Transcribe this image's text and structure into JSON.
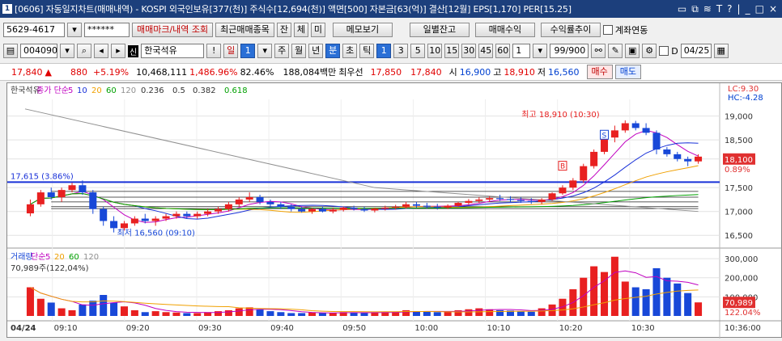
{
  "window": {
    "icon": "1",
    "title": "[0606] 자동일지차트(매매내역) - KOSPI 외국인보유[377(천)] 주식수[12,694(천)] 액면[500] 자본금[63(억)] 결산[12월] EPS[1,170] PER[15.25]",
    "controls": [
      "▭",
      "⧉",
      "≋",
      "T",
      "?",
      "|",
      "_",
      "□",
      "×"
    ]
  },
  "toolbar1": {
    "account": "5629-4617",
    "password": "******",
    "trade_mark_btn": "매매마크/내역 조회",
    "recent_btn": "최근매매종목",
    "btn_jan": "잔",
    "btn_che": "체",
    "btn_mi": "미",
    "memo_btn": "메모보기",
    "daily_btn": "일별잔고",
    "profit_btn": "매매수익",
    "rate_btn": "수익률추이",
    "account_link": "계좌연동"
  },
  "toolbar2": {
    "code": "004090",
    "name": "한국석유",
    "s_badge": "신",
    "period_day": "일",
    "period_num": "1",
    "periods": [
      "주",
      "월",
      "년"
    ],
    "minute_tabs": [
      "분",
      "초",
      "틱"
    ],
    "intervals": [
      "1",
      "3",
      "5",
      "10",
      "15",
      "30",
      "45",
      "60"
    ],
    "count_sel": "1",
    "count": "99/900",
    "date": "04/25",
    "d_label": "D"
  },
  "quote": {
    "price": "17,840",
    "change": "880",
    "rate": "+5.19%",
    "volume": "10,468,111",
    "vol_rate": "1,486.96%",
    "ratio": "82.46%",
    "amount": "188,084백만",
    "best_label": "최우선",
    "ask": "17,850",
    "bid": "17,840",
    "open_label": "시",
    "open": "16,900",
    "high_label": "고",
    "high": "18,910",
    "low_label": "저",
    "low": "16,560",
    "buy_btn": "매수",
    "sell_btn": "매도"
  },
  "chart_data": {
    "type": "candlestick",
    "price_legend": {
      "name": "한국석유",
      "ma_label": "종가 단순",
      "ma_periods": [
        "5",
        "10",
        "20",
        "60",
        "120"
      ],
      "fibs": [
        "0.236",
        "0.5",
        "0.382",
        "0.618"
      ]
    },
    "lc": "LC:9.30",
    "hc": "HC:-4.28",
    "y_ticks": [
      19000,
      18500,
      18100,
      17500,
      17000,
      16500
    ],
    "y_labels": [
      "19,000",
      "18,500",
      "18,100",
      "17,500",
      "17,000",
      "16,500"
    ],
    "last_pct": "0.89%",
    "ylim": [
      16300,
      19350
    ],
    "ref_line": {
      "value": 17615,
      "label": "17,615 (3.86%)"
    },
    "high_annot": "최고 18,910 (10:30)",
    "low_annot": "최저 16,560 (09:10)",
    "markers": {
      "buy": "B",
      "sell": "S"
    },
    "volume_legend": {
      "name": "거래량",
      "ma_label": "단순",
      "ma_periods": [
        "5",
        "20",
        "60",
        "120"
      ],
      "current": "70,989주(122,04%)"
    },
    "vol_ticks": [
      300000,
      200000,
      100000
    ],
    "vol_labels": [
      "300,000",
      "200,000",
      "100,000"
    ],
    "vol_last": "70,989",
    "vol_pct": "122.04%",
    "vol_max": 330000,
    "x_labels": [
      "04/24",
      "09:10",
      "09:20",
      "09:30",
      "09:40",
      "09:50",
      "10:00",
      "10:10",
      "10:20",
      "10:30",
      "10:36:00"
    ],
    "candles": [
      [
        16960,
        17250,
        16900,
        17150
      ],
      [
        17150,
        17450,
        17100,
        17400
      ],
      [
        17400,
        17500,
        17250,
        17300
      ],
      [
        17300,
        17500,
        17200,
        17450
      ],
      [
        17450,
        17600,
        17400,
        17550
      ],
      [
        17550,
        17650,
        17350,
        17400
      ],
      [
        17400,
        17450,
        16950,
        17050
      ],
      [
        17050,
        17100,
        16700,
        16800
      ],
      [
        16800,
        16900,
        16560,
        16650
      ],
      [
        16650,
        16800,
        16600,
        16750
      ],
      [
        16750,
        16900,
        16700,
        16850
      ],
      [
        16850,
        16950,
        16750,
        16800
      ],
      [
        16800,
        16900,
        16700,
        16850
      ],
      [
        16850,
        16950,
        16800,
        16900
      ],
      [
        16900,
        17000,
        16850,
        16950
      ],
      [
        16950,
        17000,
        16850,
        16900
      ],
      [
        16900,
        17000,
        16850,
        16950
      ],
      [
        16950,
        17050,
        16900,
        17000
      ],
      [
        17000,
        17100,
        16950,
        17050
      ],
      [
        17050,
        17200,
        17000,
        17150
      ],
      [
        17150,
        17300,
        17100,
        17250
      ],
      [
        17250,
        17400,
        17200,
        17300
      ],
      [
        17300,
        17350,
        17150,
        17200
      ],
      [
        17200,
        17250,
        17100,
        17150
      ],
      [
        17150,
        17200,
        17050,
        17100
      ],
      [
        17100,
        17150,
        17000,
        17050
      ],
      [
        17050,
        17100,
        16980,
        17000
      ],
      [
        17000,
        17080,
        16950,
        17050
      ],
      [
        17050,
        17100,
        16980,
        17000
      ],
      [
        17000,
        17080,
        16960,
        17040
      ],
      [
        17040,
        17100,
        17000,
        17080
      ],
      [
        17080,
        17120,
        17020,
        17050
      ],
      [
        17050,
        17100,
        16990,
        17020
      ],
      [
        17020,
        17080,
        16980,
        17060
      ],
      [
        17060,
        17120,
        17020,
        17080
      ],
      [
        17080,
        17140,
        17040,
        17100
      ],
      [
        17100,
        17200,
        17060,
        17150
      ],
      [
        17150,
        17200,
        17080,
        17120
      ],
      [
        17120,
        17180,
        17060,
        17100
      ],
      [
        17100,
        17160,
        17040,
        17080
      ],
      [
        17080,
        17150,
        17050,
        17120
      ],
      [
        17120,
        17200,
        17100,
        17180
      ],
      [
        17180,
        17260,
        17140,
        17220
      ],
      [
        17220,
        17300,
        17180,
        17250
      ],
      [
        17250,
        17320,
        17200,
        17280
      ],
      [
        17280,
        17350,
        17220,
        17260
      ],
      [
        17260,
        17320,
        17200,
        17240
      ],
      [
        17240,
        17300,
        17180,
        17220
      ],
      [
        17220,
        17280,
        17160,
        17200
      ],
      [
        17200,
        17280,
        17150,
        17250
      ],
      [
        17250,
        17400,
        17220,
        17380
      ],
      [
        17380,
        17550,
        17350,
        17500
      ],
      [
        17500,
        17700,
        17450,
        17650
      ],
      [
        17650,
        18000,
        17600,
        17950
      ],
      [
        17950,
        18300,
        17900,
        18250
      ],
      [
        18250,
        18600,
        18200,
        18550
      ],
      [
        18550,
        18800,
        18450,
        18700
      ],
      [
        18700,
        18910,
        18650,
        18850
      ],
      [
        18850,
        18900,
        18700,
        18750
      ],
      [
        18750,
        18850,
        18600,
        18650
      ],
      [
        18650,
        18700,
        18200,
        18300
      ],
      [
        18300,
        18350,
        18150,
        18200
      ],
      [
        18200,
        18250,
        18050,
        18100
      ],
      [
        18100,
        18150,
        17950,
        18050
      ],
      [
        18050,
        18200,
        18000,
        18150
      ]
    ],
    "volumes": [
      150000,
      90000,
      70000,
      40000,
      30000,
      60000,
      80000,
      110000,
      70000,
      50000,
      30000,
      20000,
      25000,
      20000,
      18000,
      15000,
      15000,
      20000,
      25000,
      30000,
      40000,
      45000,
      35000,
      25000,
      20000,
      15000,
      15000,
      18000,
      15000,
      16000,
      20000,
      18000,
      15000,
      18000,
      20000,
      22000,
      30000,
      25000,
      22000,
      20000,
      22000,
      30000,
      35000,
      40000,
      35000,
      30000,
      28000,
      25000,
      22000,
      40000,
      60000,
      90000,
      140000,
      200000,
      260000,
      230000,
      310000,
      180000,
      150000,
      140000,
      250000,
      200000,
      170000,
      120000,
      70989
    ]
  }
}
